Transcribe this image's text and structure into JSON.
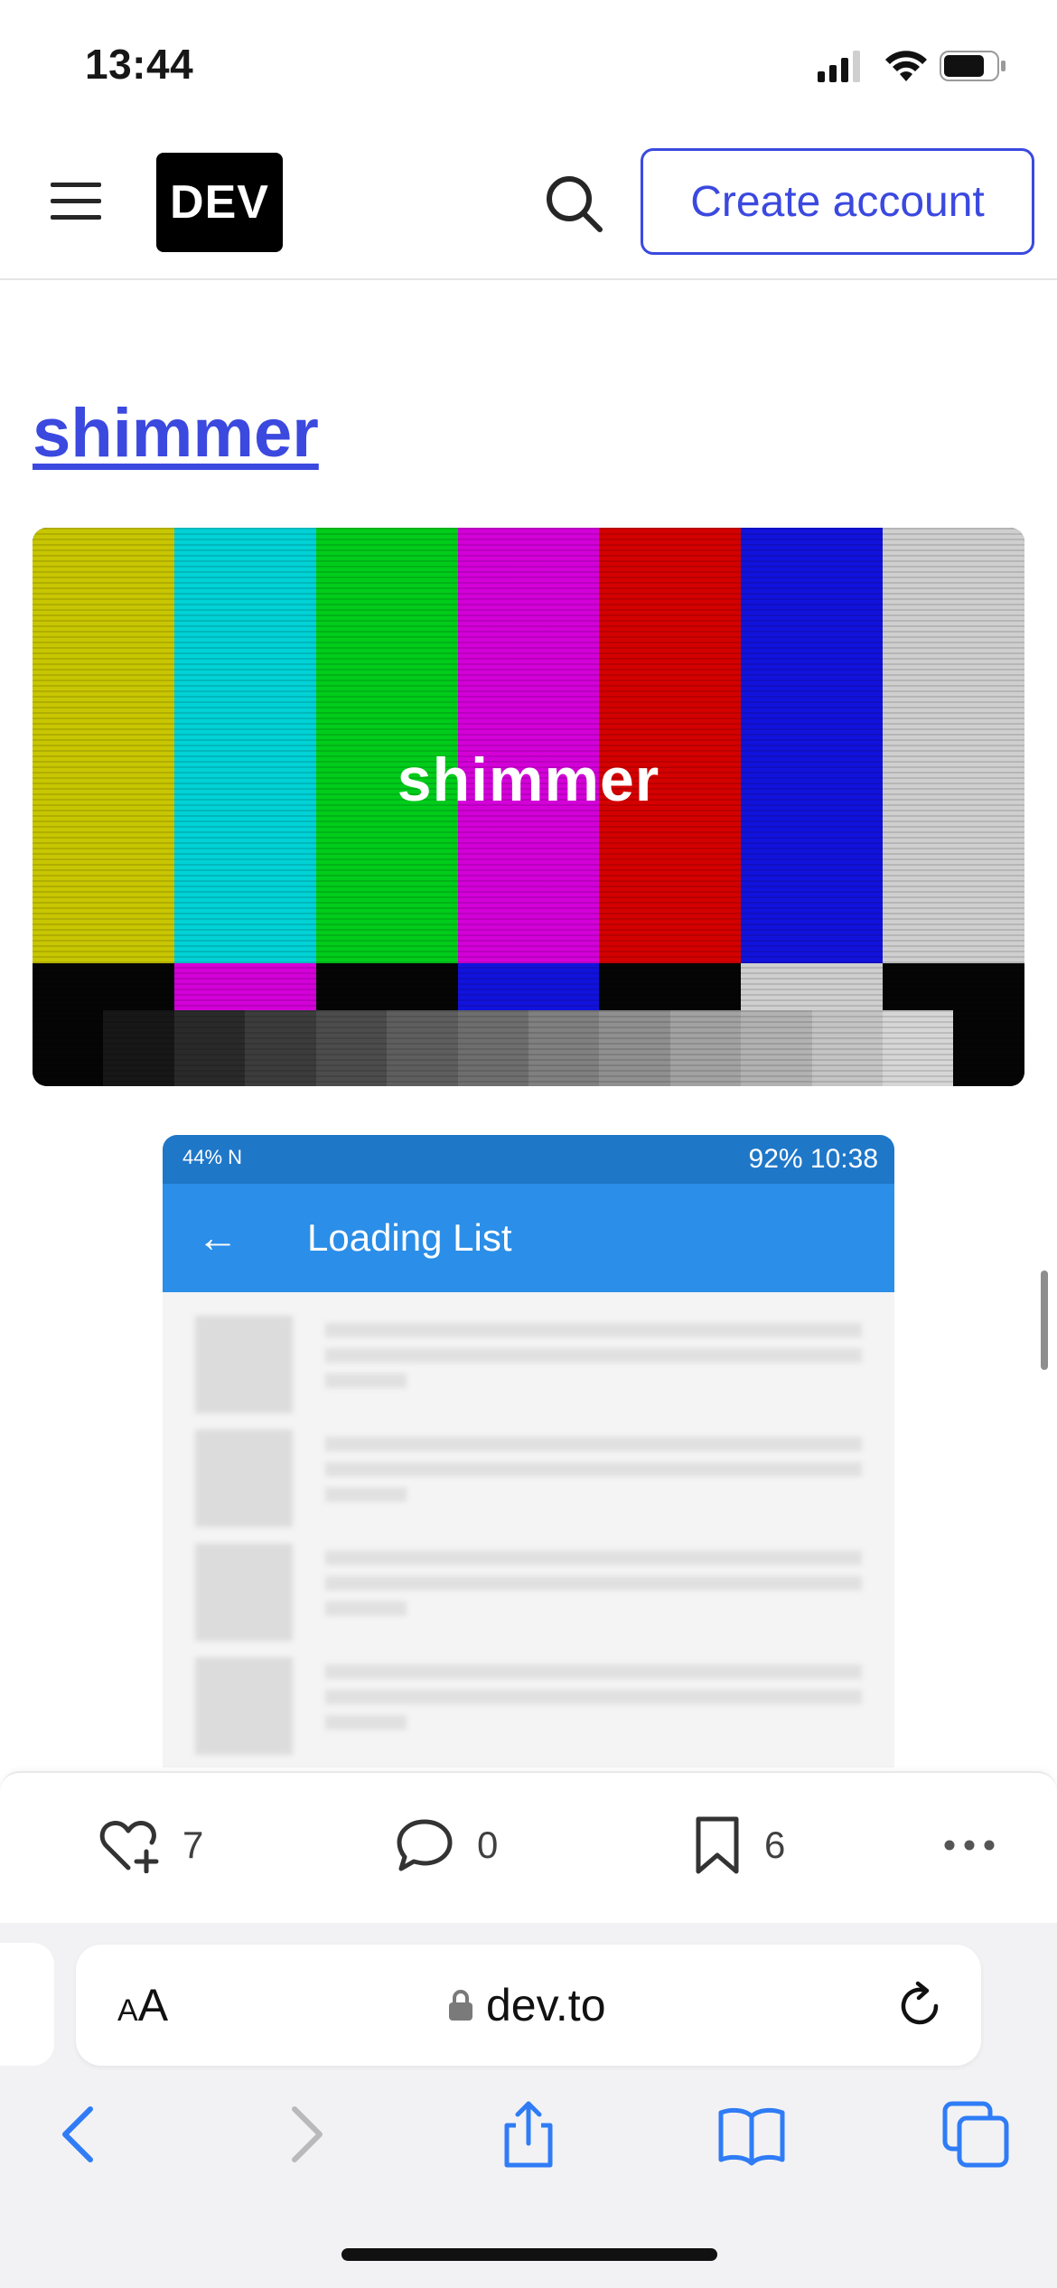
{
  "status_bar": {
    "time": "13:44"
  },
  "header": {
    "logo_text": "DEV",
    "create_account_label": "Create account"
  },
  "article": {
    "title": "shimmer",
    "cover_text": "shimmer"
  },
  "phone_screenshot": {
    "status_left": "44% N",
    "status_right": "92% 10:38",
    "back_arrow": "←",
    "title": "Loading List"
  },
  "reactions": {
    "likes": "7",
    "comments": "0",
    "bookmarks": "6"
  },
  "browser": {
    "text_size_label": "AA",
    "url": "dev.to"
  },
  "colors": {
    "accent": "#3b49df",
    "ios_blue": "#2f7cf6"
  },
  "icons": [
    "menu-icon",
    "search-icon",
    "heart-plus-icon",
    "comment-icon",
    "bookmark-icon",
    "more-icon",
    "lock-icon",
    "reload-icon",
    "back-icon",
    "forward-icon",
    "share-icon",
    "bookmarks-book-icon",
    "tabs-icon"
  ]
}
